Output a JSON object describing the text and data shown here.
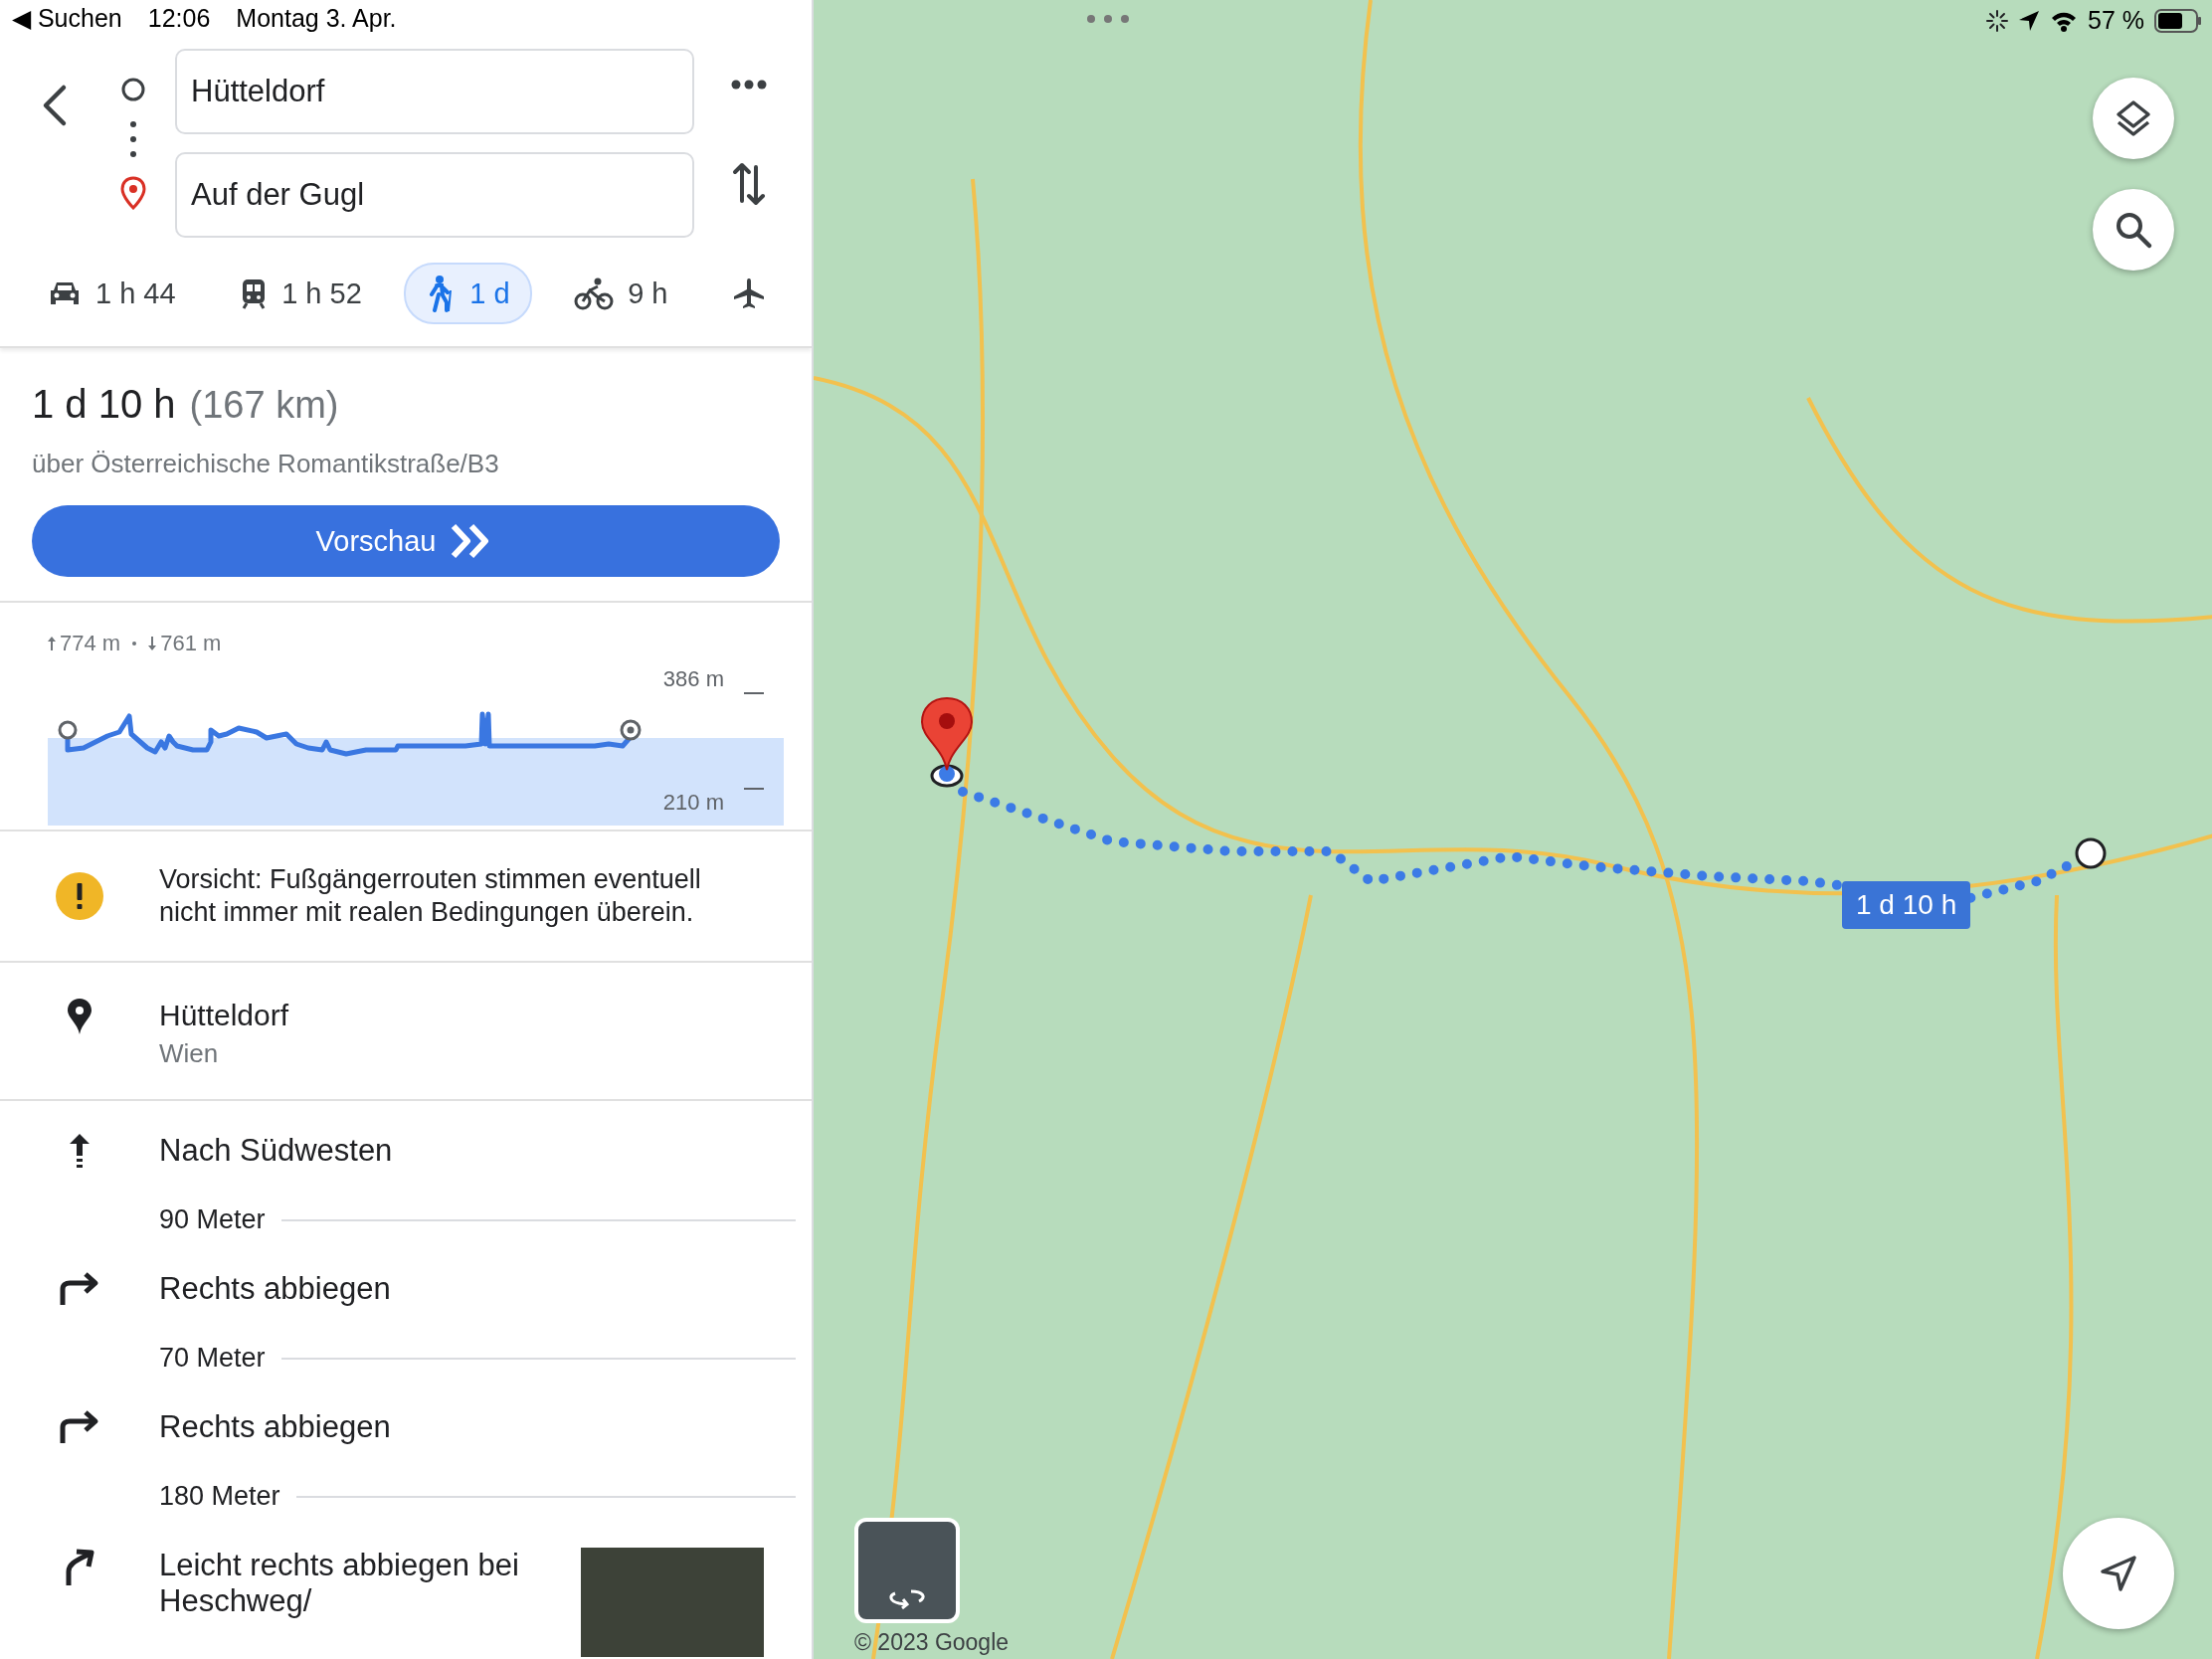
{
  "status_bar": {
    "back_app": "◀ Suchen",
    "time": "12:06",
    "date": "Montag 3. Apr.",
    "battery": "57 %"
  },
  "route_inputs": [
    {
      "kind": "origin",
      "value": "Hütteldorf"
    },
    {
      "kind": "destination",
      "value": "Auf der Gugl"
    }
  ],
  "travel_modes": [
    {
      "kind": "car",
      "label": "1 h 44",
      "selected": false
    },
    {
      "kind": "train",
      "label": "1 h 52",
      "selected": false
    },
    {
      "kind": "walk",
      "label": "1 d",
      "selected": true
    },
    {
      "kind": "bike",
      "label": "9 h",
      "selected": false
    },
    {
      "kind": "flight",
      "selected": false
    }
  ],
  "summary": {
    "duration": "1 d 10 h",
    "distance": "(167 km)",
    "via": "über Österreichische Romantikstraße/B3",
    "preview_button": "Vorschau"
  },
  "elevation": {
    "ascent": "774 m",
    "descent": "761 m",
    "max_label": "386 m",
    "min_label": "210 m"
  },
  "warning": "Vorsicht: Fußgängerrouten stimmen eventuell nicht immer mit realen Bedingungen überein.",
  "start": {
    "name": "Hütteldorf",
    "region": "Wien"
  },
  "steps": [
    {
      "kind": "straight",
      "instruction": "Nach Südwesten",
      "distance": "90 Meter"
    },
    {
      "kind": "right",
      "instruction": "Rechts abbiegen",
      "distance": "70 Meter"
    },
    {
      "kind": "right",
      "instruction": "Rechts abbiegen",
      "distance": "180 Meter"
    },
    {
      "kind": "slight-right",
      "instruction": "Leicht rechts abbiegen bei Heschweg/",
      "has_photo": true
    }
  ],
  "map": {
    "route_badge": "1 d 10 h",
    "copyright": "© 2023 Google"
  }
}
